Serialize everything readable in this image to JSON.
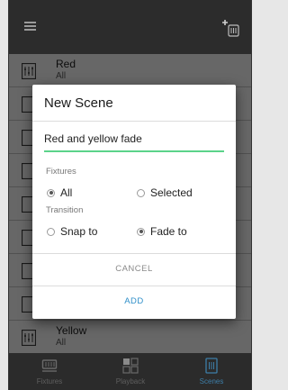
{
  "header": {
    "menu_icon": "hamburger-menu-icon",
    "add_icon": "add-scene-icon"
  },
  "scenes": [
    {
      "name": "Red",
      "fixtures": "All"
    },
    {
      "name": "Yellow",
      "fixtures": "All"
    }
  ],
  "dialog": {
    "title": "New Scene",
    "name_value": "Red and yellow fade",
    "fixtures_label": "Fixtures",
    "fixtures_options": [
      {
        "label": "All",
        "selected": true
      },
      {
        "label": "Selected",
        "selected": false
      }
    ],
    "transition_label": "Transition",
    "transition_options": [
      {
        "label": "Snap to",
        "selected": false
      },
      {
        "label": "Fade to",
        "selected": true
      }
    ],
    "cancel_label": "CANCEL",
    "add_label": "ADD"
  },
  "bottom_nav": [
    {
      "label": "Fixtures",
      "icon": "fixtures-icon",
      "active": false
    },
    {
      "label": "Playback",
      "icon": "playback-grid-icon",
      "active": false
    },
    {
      "label": "Scenes",
      "icon": "scenes-icon",
      "active": true
    }
  ],
  "colors": {
    "accent": "#3d7ea8",
    "input_underline": "#5bd38a",
    "app_bar": "#2c2c2c"
  }
}
